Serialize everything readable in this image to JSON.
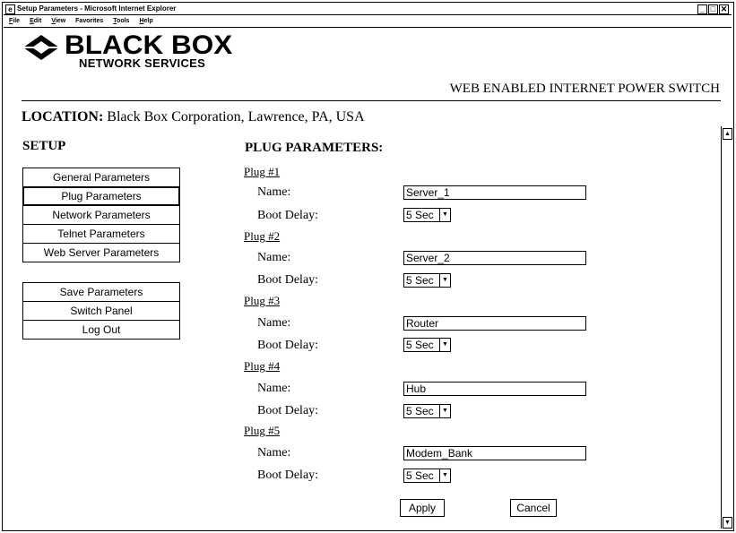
{
  "window": {
    "title": "Setup Parameters - Microsoft Internet Explorer"
  },
  "menu": [
    {
      "u": "F",
      "rest": "ile"
    },
    {
      "u": "E",
      "rest": "dit"
    },
    {
      "u": "V",
      "rest": "iew"
    },
    {
      "u": "",
      "rest": "Favorites"
    },
    {
      "u": "T",
      "rest": "ools"
    },
    {
      "u": "H",
      "rest": "elp"
    }
  ],
  "brand": {
    "name": "BLACK BOX",
    "sub": "NETWORK SERVICES",
    "product": "WEB ENABLED INTERNET POWER SWITCH"
  },
  "location": {
    "label": "LOCATION:",
    "value": "Black Box Corporation, Lawrence, PA, USA"
  },
  "setup": {
    "heading": "SETUP",
    "nav": [
      "General Parameters",
      "Plug Parameters",
      "Network Parameters",
      "Telnet Parameters",
      "Web Server Parameters"
    ],
    "actions": [
      "Save Parameters",
      "Switch Panel",
      "Log Out"
    ]
  },
  "plug_params": {
    "heading": "PLUG PARAMETERS:",
    "name_label": "Name:",
    "delay_label": "Boot Delay:",
    "plugs": [
      {
        "header": "Plug #1",
        "name": "Server_1",
        "delay": "5 Sec"
      },
      {
        "header": "Plug #2",
        "name": "Server_2",
        "delay": "5 Sec"
      },
      {
        "header": "Plug #3",
        "name": "Router",
        "delay": "5 Sec"
      },
      {
        "header": "Plug #4",
        "name": "Hub",
        "delay": "5 Sec"
      },
      {
        "header": "Plug #5",
        "name": "Modem_Bank",
        "delay": "5 Sec"
      }
    ]
  },
  "buttons": {
    "apply": "Apply",
    "cancel": "Cancel"
  }
}
